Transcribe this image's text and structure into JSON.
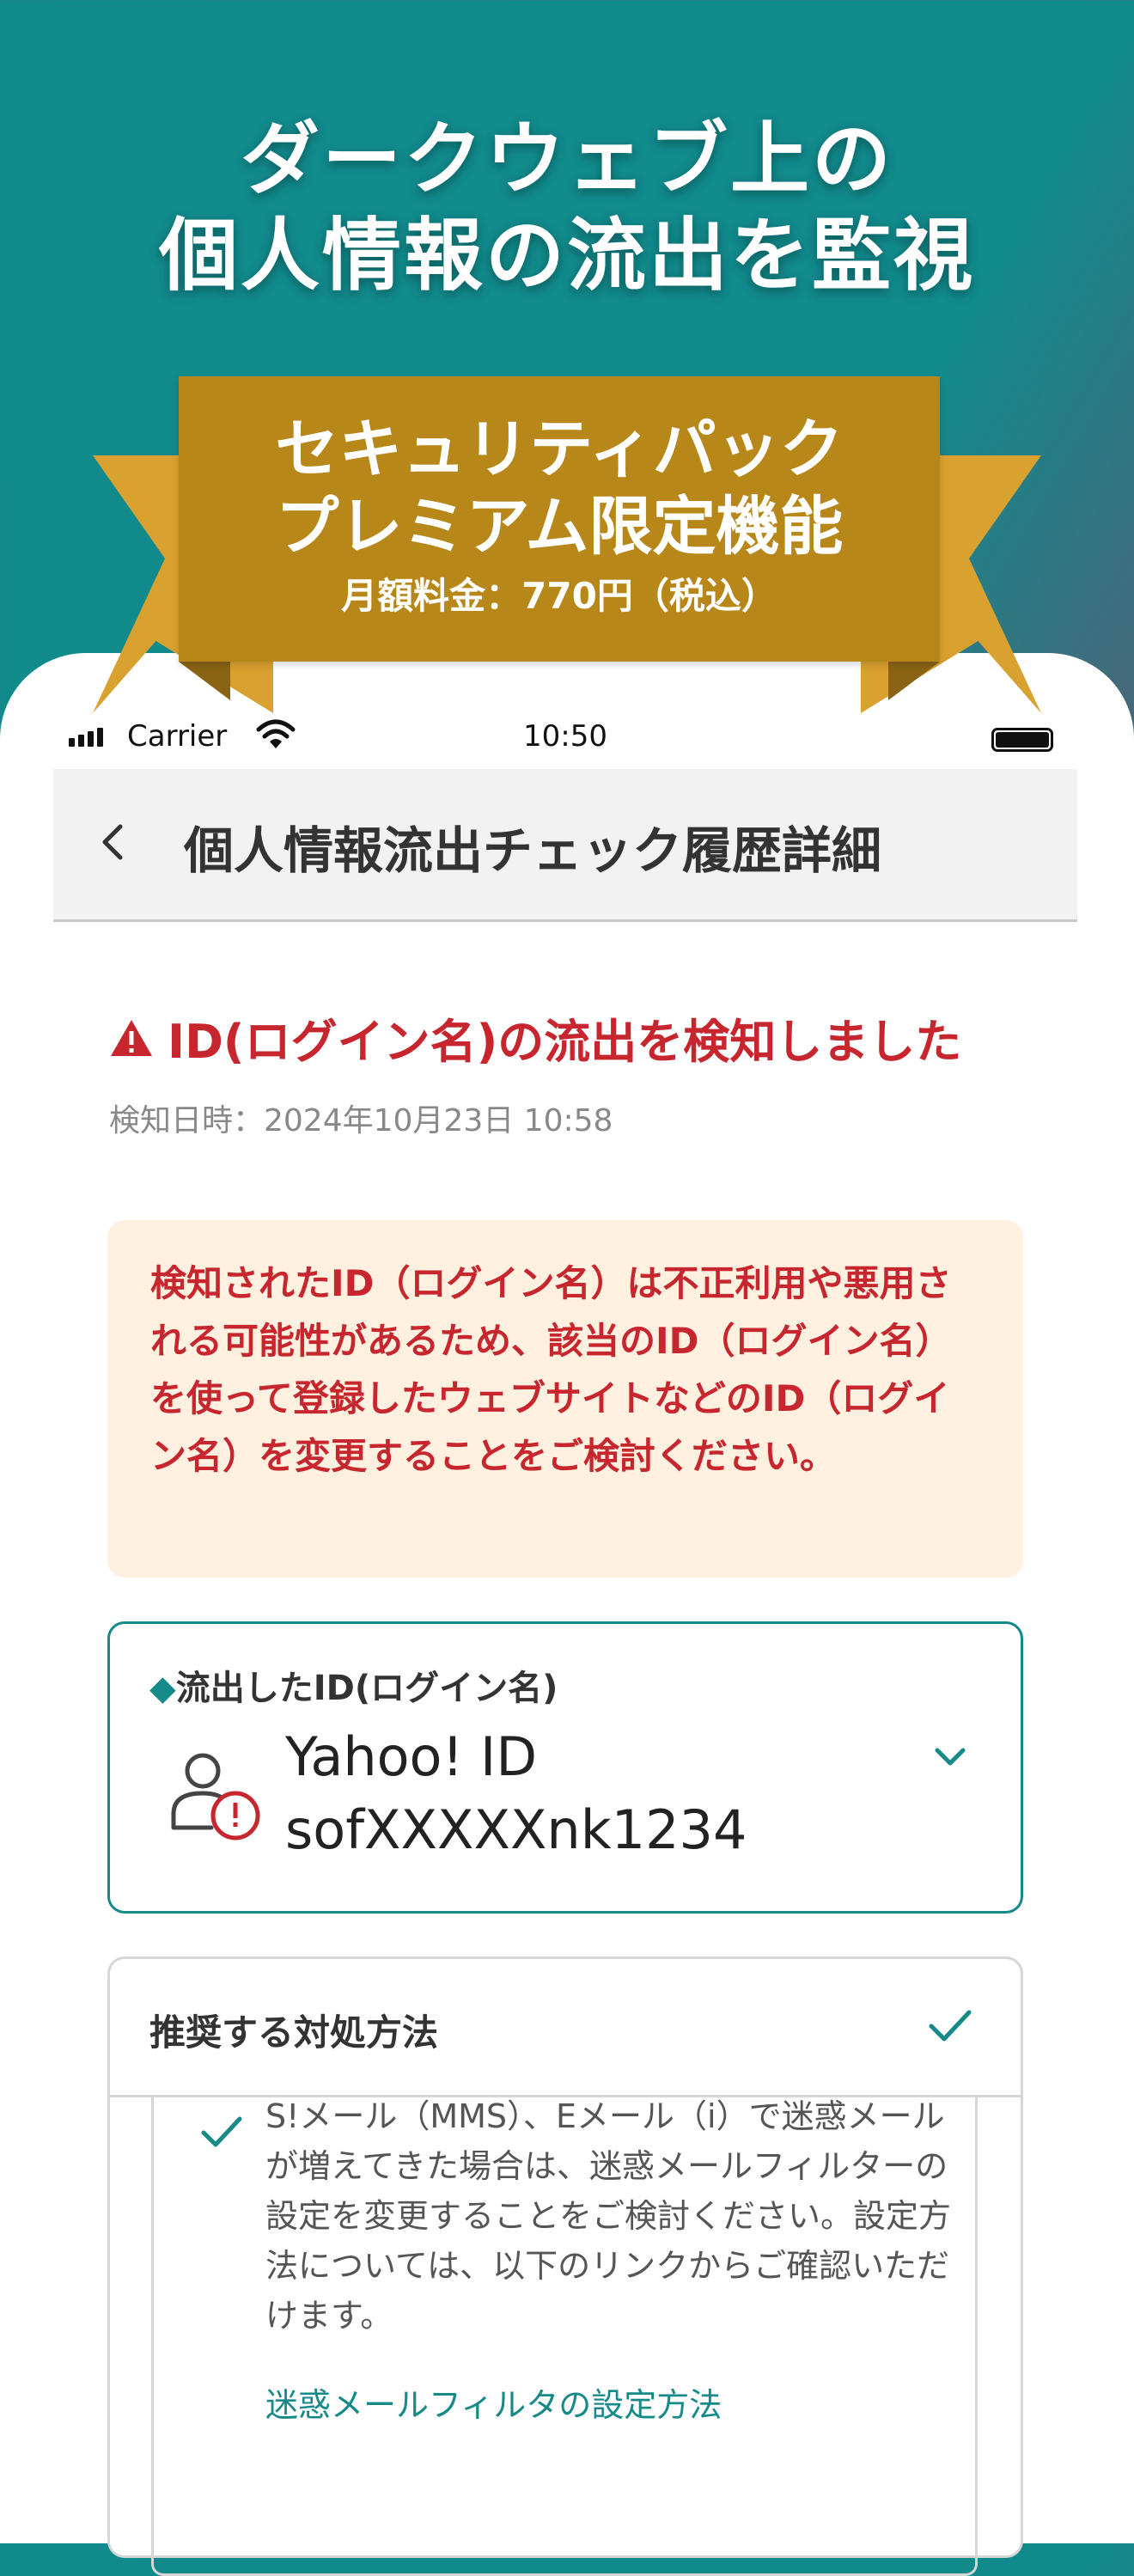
{
  "promo": {
    "headline_line1": "ダークウェブ上の",
    "headline_line2": "個人情報の流出を監視",
    "ribbon_line1": "セキュリティパック",
    "ribbon_line2": "プレミアム限定機能",
    "price": "月額料金：770円（税込）"
  },
  "status_bar": {
    "carrier": "Carrier",
    "time": "10:50"
  },
  "nav": {
    "title": "個人情報流出チェック履歴詳細"
  },
  "alert": {
    "title": "ID(ログイン名)の流出を検知しました",
    "detected_at": "検知日時：2024年10月23日 10:58"
  },
  "warning": {
    "text": "検知されたID（ログイン名）は不正利用や悪用される可能性があるため、該当のID（ログイン名）を使って登録したウェブサイトなどのID（ログイン名）を変更することをご検討ください。"
  },
  "leaked_id": {
    "label_mark": "◆",
    "label": "流出したID(ログイン名)",
    "service": "Yahoo! ID",
    "value": "sofXXXXXnk1234"
  },
  "recommendation": {
    "title": "推奨する対処方法",
    "item_text": "S!メール（MMS）、Eメール（i）で迷惑メールが増えてきた場合は、迷惑メールフィルターの設定を変更することをご検討ください。設定方法については、以下のリンクからご確認いただけます。",
    "link": "迷惑メールフィルタの設定方法"
  },
  "colors": {
    "accent_teal": "#168a88",
    "alert_red": "#c8262e",
    "ribbon_gold": "#b8871a",
    "warning_bg": "#fff0e0"
  },
  "icons": [
    "back-chevron-icon",
    "wifi-icon",
    "battery-icon",
    "warning-triangle-icon",
    "user-alert-icon",
    "chevron-down-icon",
    "checkmark-icon"
  ]
}
